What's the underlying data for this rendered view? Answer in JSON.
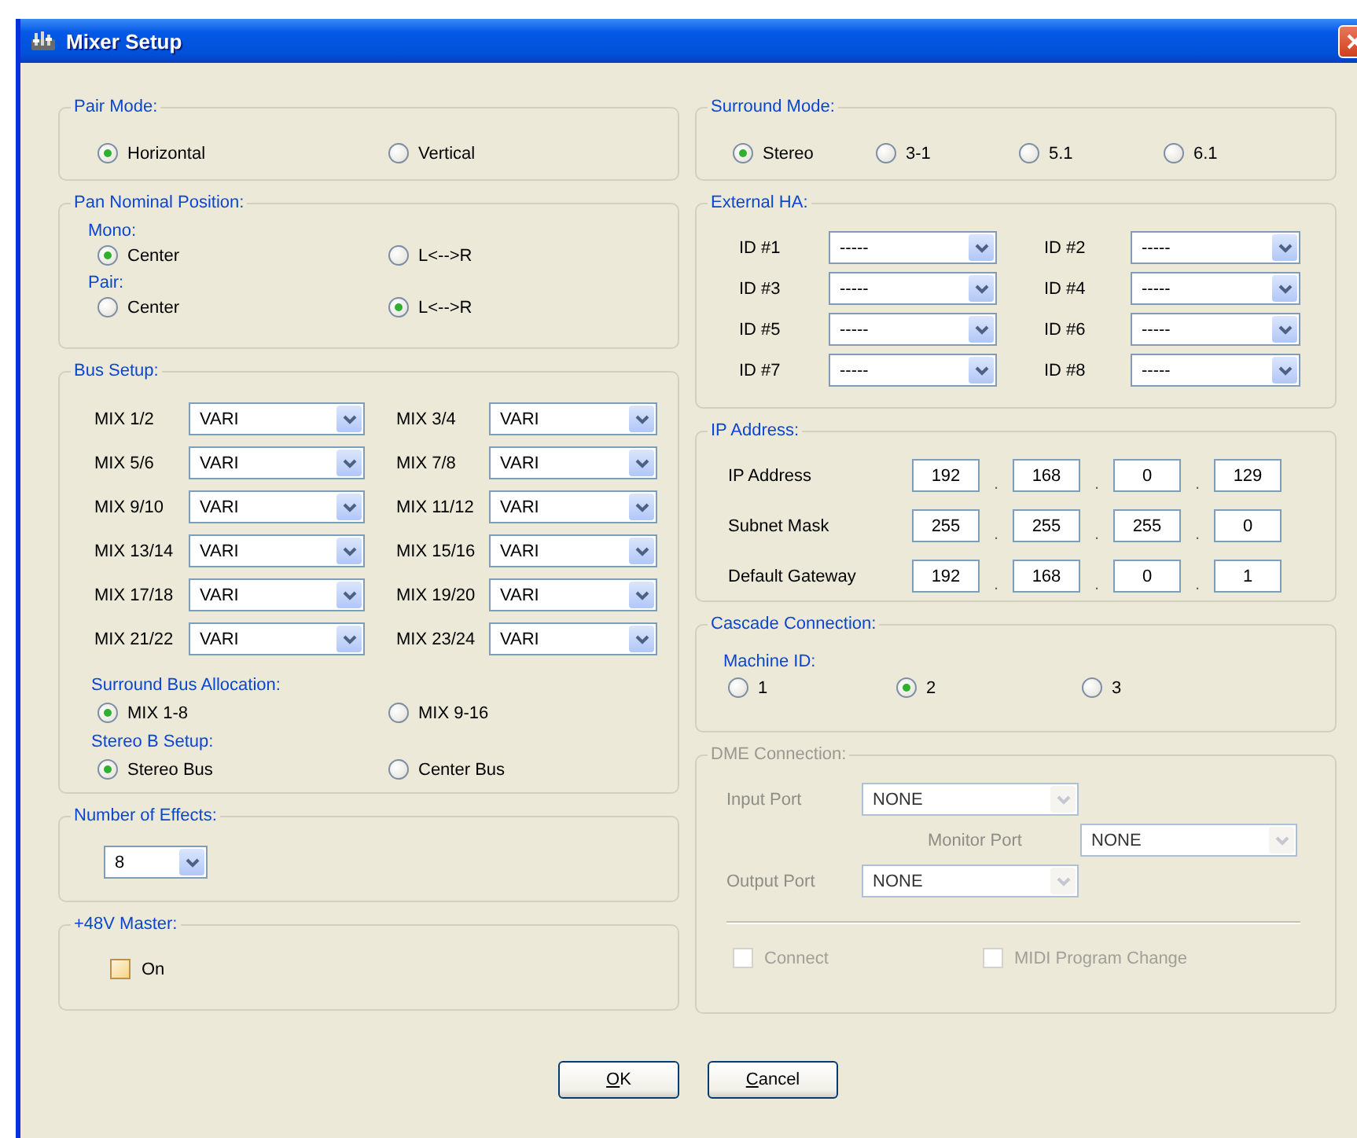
{
  "window": {
    "title": "Mixer Setup"
  },
  "pair_mode": {
    "label": "Pair Mode:",
    "options": [
      {
        "label": "Horizontal",
        "selected": true
      },
      {
        "label": "Vertical",
        "selected": false
      }
    ]
  },
  "pan_nominal_position": {
    "label": "Pan Nominal Position:",
    "subgroups": [
      {
        "label": "Mono:",
        "options": [
          {
            "label": "Center",
            "selected": true
          },
          {
            "label": "L<-->R",
            "selected": false
          }
        ]
      },
      {
        "label": "Pair:",
        "options": [
          {
            "label": "Center",
            "selected": false
          },
          {
            "label": "L<-->R",
            "selected": true
          }
        ]
      }
    ]
  },
  "bus_setup": {
    "label": "Bus Setup:",
    "buses": [
      {
        "label": "MIX 1/2",
        "value": "VARI"
      },
      {
        "label": "MIX 3/4",
        "value": "VARI"
      },
      {
        "label": "MIX 5/6",
        "value": "VARI"
      },
      {
        "label": "MIX 7/8",
        "value": "VARI"
      },
      {
        "label": "MIX 9/10",
        "value": "VARI"
      },
      {
        "label": "MIX 11/12",
        "value": "VARI"
      },
      {
        "label": "MIX 13/14",
        "value": "VARI"
      },
      {
        "label": "MIX 15/16",
        "value": "VARI"
      },
      {
        "label": "MIX 17/18",
        "value": "VARI"
      },
      {
        "label": "MIX 19/20",
        "value": "VARI"
      },
      {
        "label": "MIX 21/22",
        "value": "VARI"
      },
      {
        "label": "MIX 23/24",
        "value": "VARI"
      }
    ],
    "subgroups": [
      {
        "label": "Surround Bus Allocation:",
        "options": [
          {
            "label": "MIX 1-8",
            "selected": true
          },
          {
            "label": "MIX 9-16",
            "selected": false
          }
        ]
      },
      {
        "label": "Stereo B Setup:",
        "options": [
          {
            "label": "Stereo Bus",
            "selected": true
          },
          {
            "label": "Center Bus",
            "selected": false
          }
        ]
      }
    ]
  },
  "number_of_effects": {
    "label": "Number of Effects:",
    "value": "8"
  },
  "phantom_master": {
    "label": "+48V Master:",
    "checkbox": {
      "label": "On",
      "checked": false
    }
  },
  "surround_mode": {
    "label": "Surround Mode:",
    "options": [
      {
        "label": "Stereo",
        "selected": true
      },
      {
        "label": "3-1",
        "selected": false
      },
      {
        "label": "5.1",
        "selected": false
      },
      {
        "label": "6.1",
        "selected": false
      }
    ]
  },
  "external_ha": {
    "label": "External HA:",
    "ids": [
      {
        "label": "ID #1",
        "value": "-----"
      },
      {
        "label": "ID #2",
        "value": "-----"
      },
      {
        "label": "ID #3",
        "value": "-----"
      },
      {
        "label": "ID #4",
        "value": "-----"
      },
      {
        "label": "ID #5",
        "value": "-----"
      },
      {
        "label": "ID #6",
        "value": "-----"
      },
      {
        "label": "ID #7",
        "value": "-----"
      },
      {
        "label": "ID #8",
        "value": "-----"
      }
    ]
  },
  "ip_address": {
    "label": "IP Address:",
    "separator": ".",
    "rows": [
      {
        "label": "IP Address",
        "octets": [
          "192",
          "168",
          "0",
          "129"
        ]
      },
      {
        "label": "Subnet Mask",
        "octets": [
          "255",
          "255",
          "255",
          "0"
        ]
      },
      {
        "label": "Default Gateway",
        "octets": [
          "192",
          "168",
          "0",
          "1"
        ]
      }
    ]
  },
  "cascade_connection": {
    "label": "Cascade Connection:",
    "sublabel": "Machine ID:",
    "options": [
      {
        "label": "1",
        "selected": false
      },
      {
        "label": "2",
        "selected": true
      },
      {
        "label": "3",
        "selected": false
      }
    ]
  },
  "dme_connection": {
    "label": "DME Connection:",
    "disabled": true,
    "ports": [
      {
        "label": "Input Port",
        "value": "NONE"
      },
      {
        "label": "Monitor Port",
        "value": "NONE"
      },
      {
        "label": "Output Port",
        "value": "NONE"
      }
    ],
    "checkboxes": [
      {
        "label": "Connect",
        "checked": false
      },
      {
        "label": "MIDI Program Change",
        "checked": false
      }
    ]
  },
  "buttons": [
    {
      "label": "OK"
    },
    {
      "label": "Cancel"
    }
  ]
}
